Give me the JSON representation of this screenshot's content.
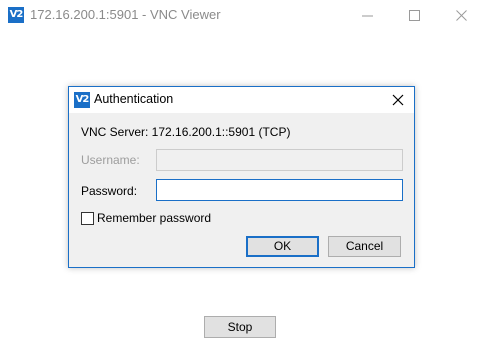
{
  "window": {
    "title": "172.16.200.1:5901 - VNC Viewer",
    "logo": "V2",
    "stop_label": "Stop"
  },
  "dialog": {
    "title": "Authentication",
    "logo": "V2",
    "server": "VNC Server: 172.16.200.1::5901 (TCP)",
    "username_label": "Username:",
    "username_value": "",
    "password_label": "Password:",
    "password_value": "",
    "remember_label": "Remember password",
    "remember_checked": false,
    "ok_label": "OK",
    "cancel_label": "Cancel"
  },
  "colors": {
    "accent": "#1a6fc7",
    "dialog_bg": "#f0f0f0",
    "button_bg": "#e1e1e1"
  },
  "icons": [
    "vnc-logo-icon",
    "minimize-icon",
    "maximize-icon",
    "close-icon"
  ]
}
